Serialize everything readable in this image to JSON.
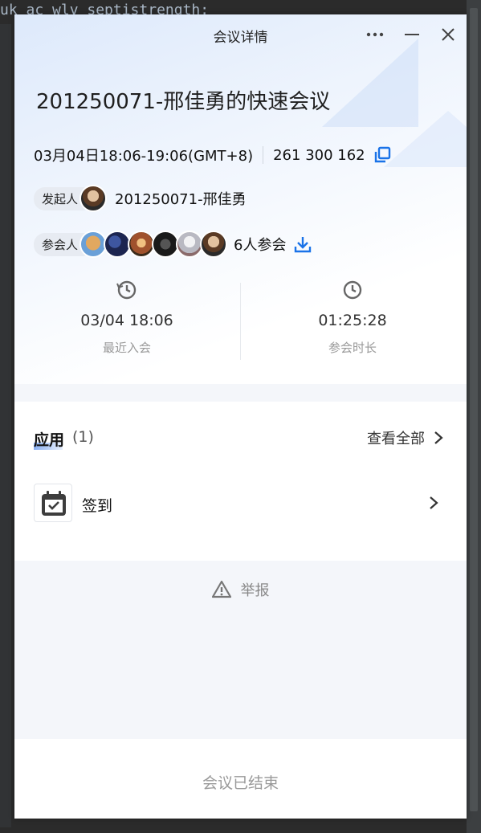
{
  "background": {
    "code_line": "uk ac wlv septistrength:"
  },
  "window": {
    "title": "会议详情",
    "more_icon": "more-horizontal-icon",
    "minimize_icon": "minimize-icon",
    "close_icon": "close-icon"
  },
  "meeting": {
    "title": "201250071-邢佳勇的快速会议",
    "time": "03月04日18:06-19:06(GMT+8)",
    "id": "261 300 162"
  },
  "host": {
    "label": "发起人",
    "name": "201250071-邢佳勇"
  },
  "attendees": {
    "label": "参会人",
    "count_text": "6人参会",
    "avatar_colors": [
      "#c98f4a",
      "#2c3b78",
      "#a0522d",
      "#2b2b2b",
      "#b9b9c2",
      "#7a5a3a"
    ]
  },
  "stats": {
    "recent_join": {
      "value": "03/04 18:06",
      "label": "最近入会"
    },
    "duration": {
      "value": "01:25:28",
      "label": "参会时长"
    }
  },
  "apps": {
    "title": "应用",
    "count": "(1)",
    "view_all": "查看全部",
    "items": [
      {
        "name": "签到",
        "icon": "calendar-check-icon"
      }
    ]
  },
  "report": {
    "label": "举报"
  },
  "footer": {
    "status": "会议已结束"
  },
  "colors": {
    "accent": "#1a73e8",
    "muted": "#999999"
  }
}
